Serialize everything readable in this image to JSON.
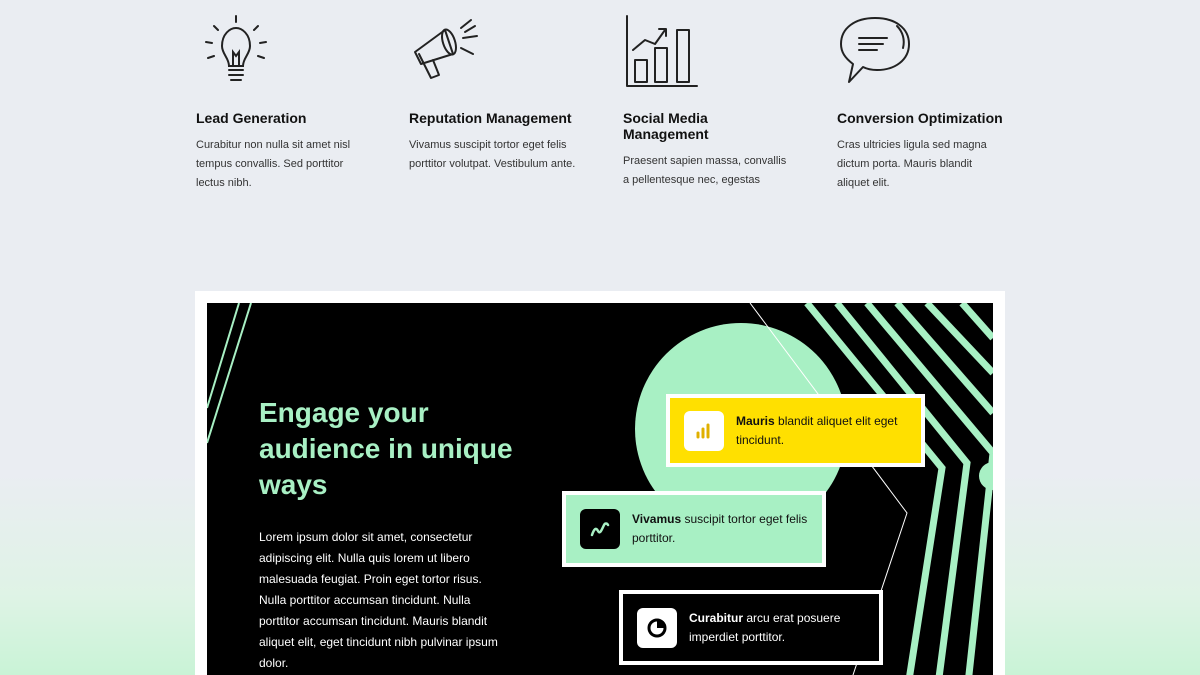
{
  "features": [
    {
      "icon": "lightbulb-icon",
      "title": "Lead Generation",
      "description": "Curabitur non nulla sit amet nisl tempus convallis. Sed porttitor lectus nibh."
    },
    {
      "icon": "megaphone-icon",
      "title": "Reputation Management",
      "description": "Vivamus suscipit tortor eget felis porttitor volutpat. Vestibulum ante."
    },
    {
      "icon": "bar-chart-icon",
      "title": "Social Media Management",
      "description": "Praesent sapien massa, convallis a pellentesque nec, egestas"
    },
    {
      "icon": "speech-bubble-icon",
      "title": "Conversion Optimization",
      "description": "Cras ultricies ligula sed magna dictum porta. Mauris blandit aliquet elit."
    }
  ],
  "card": {
    "headline": "Engage your audience in unique ways",
    "body": "Lorem ipsum dolor sit amet, consectetur adipiscing elit. Nulla quis lorem ut libero malesuada feugiat. Proin eget tortor risus. Nulla porttitor accumsan tincidunt. Nulla porttitor accumsan tincidunt. Mauris blandit aliquet elit, eget tincidunt nibh pulvinar ipsum dolor.",
    "pills": [
      {
        "icon": "bar-chart-icon",
        "bold": "Mauris",
        "text": " blandit aliquet elit eget tincidunt."
      },
      {
        "icon": "squiggle-icon",
        "bold": "Vivamus",
        "text": " suscipit tortor eget felis porttitor."
      },
      {
        "icon": "pie-chart-icon",
        "bold": "Curabitur",
        "text": " arcu erat posuere imperdiet porttitor."
      }
    ]
  },
  "colors": {
    "accent_green": "#a8f0c4",
    "accent_yellow": "#ffe000",
    "card_background": "#000000",
    "page_background": "#eaedf2"
  }
}
